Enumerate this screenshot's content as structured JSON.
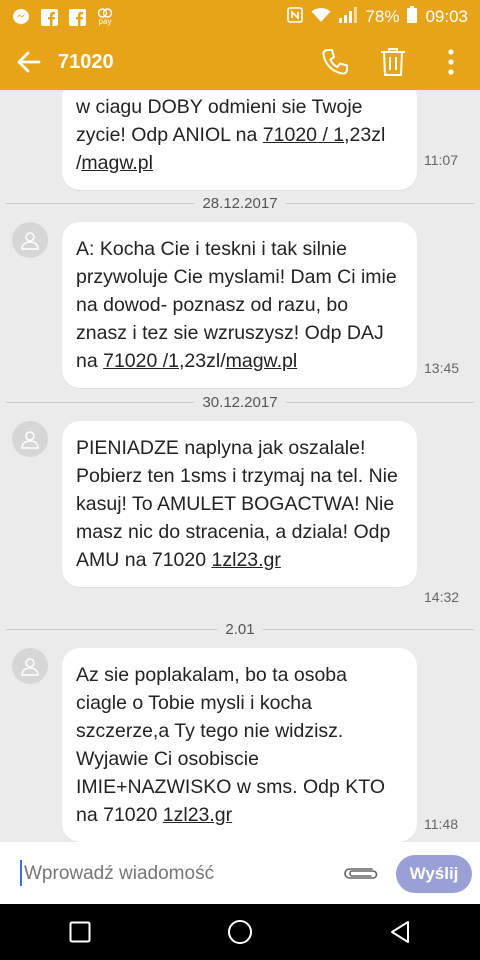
{
  "status_bar": {
    "battery": "78%",
    "time": "09:03",
    "notification_icons": [
      "messenger-icon",
      "facebook-icon",
      "facebook-icon",
      "pay-icon"
    ],
    "pay_label": "pay"
  },
  "app_bar": {
    "title": "71020"
  },
  "messages": [
    {
      "pre": "w ciagu DOBY odmieni sie Twoje zycie! Odp ANIOL na ",
      "link1": "71020 / 1",
      "mid": ",23zl /",
      "link2": "magw.pl",
      "post": "",
      "time": "11:07"
    },
    {
      "date": "28.12.2017",
      "pre": "A: Kocha Cie i teskni i tak silnie przywoluje Cie myslami! Dam Ci imie na dowod- poznasz od razu, bo znasz i tez sie wzruszysz! Odp DAJ na ",
      "link1": "71020 /1",
      "mid": ",23zl/",
      "link2": "magw.pl",
      "post": "",
      "time": "13:45"
    },
    {
      "date": "30.12.2017",
      "pre": "PIENIADZE naplyna jak oszalale! Pobierz ten 1sms i trzymaj na tel. Nie kasuj! To AMULET BOGACTWA! Nie masz nic do stracenia, a dziala! Odp AMU na 71020 ",
      "link1": "1zl23.gr",
      "mid": "",
      "link2": "",
      "post": "",
      "time": "14:32"
    },
    {
      "date": "2.01",
      "pre": "Az sie poplakalam, bo ta osoba ciagle o Tobie mysli i kocha szczerze,a Ty tego nie widzisz. Wyjawie Ci osobiscie IMIE+NAZWISKO w sms. Odp KTO na 71020 ",
      "link1": "1zl23.gr",
      "mid": "",
      "link2": "",
      "post": "",
      "time": "11:48"
    }
  ],
  "composer": {
    "placeholder": "Wprowadź wiadomość",
    "send_label": "Wyślij"
  },
  "colors": {
    "accent": "#e8a418",
    "send_button": "#9aa0d6",
    "background": "#ebebeb"
  }
}
